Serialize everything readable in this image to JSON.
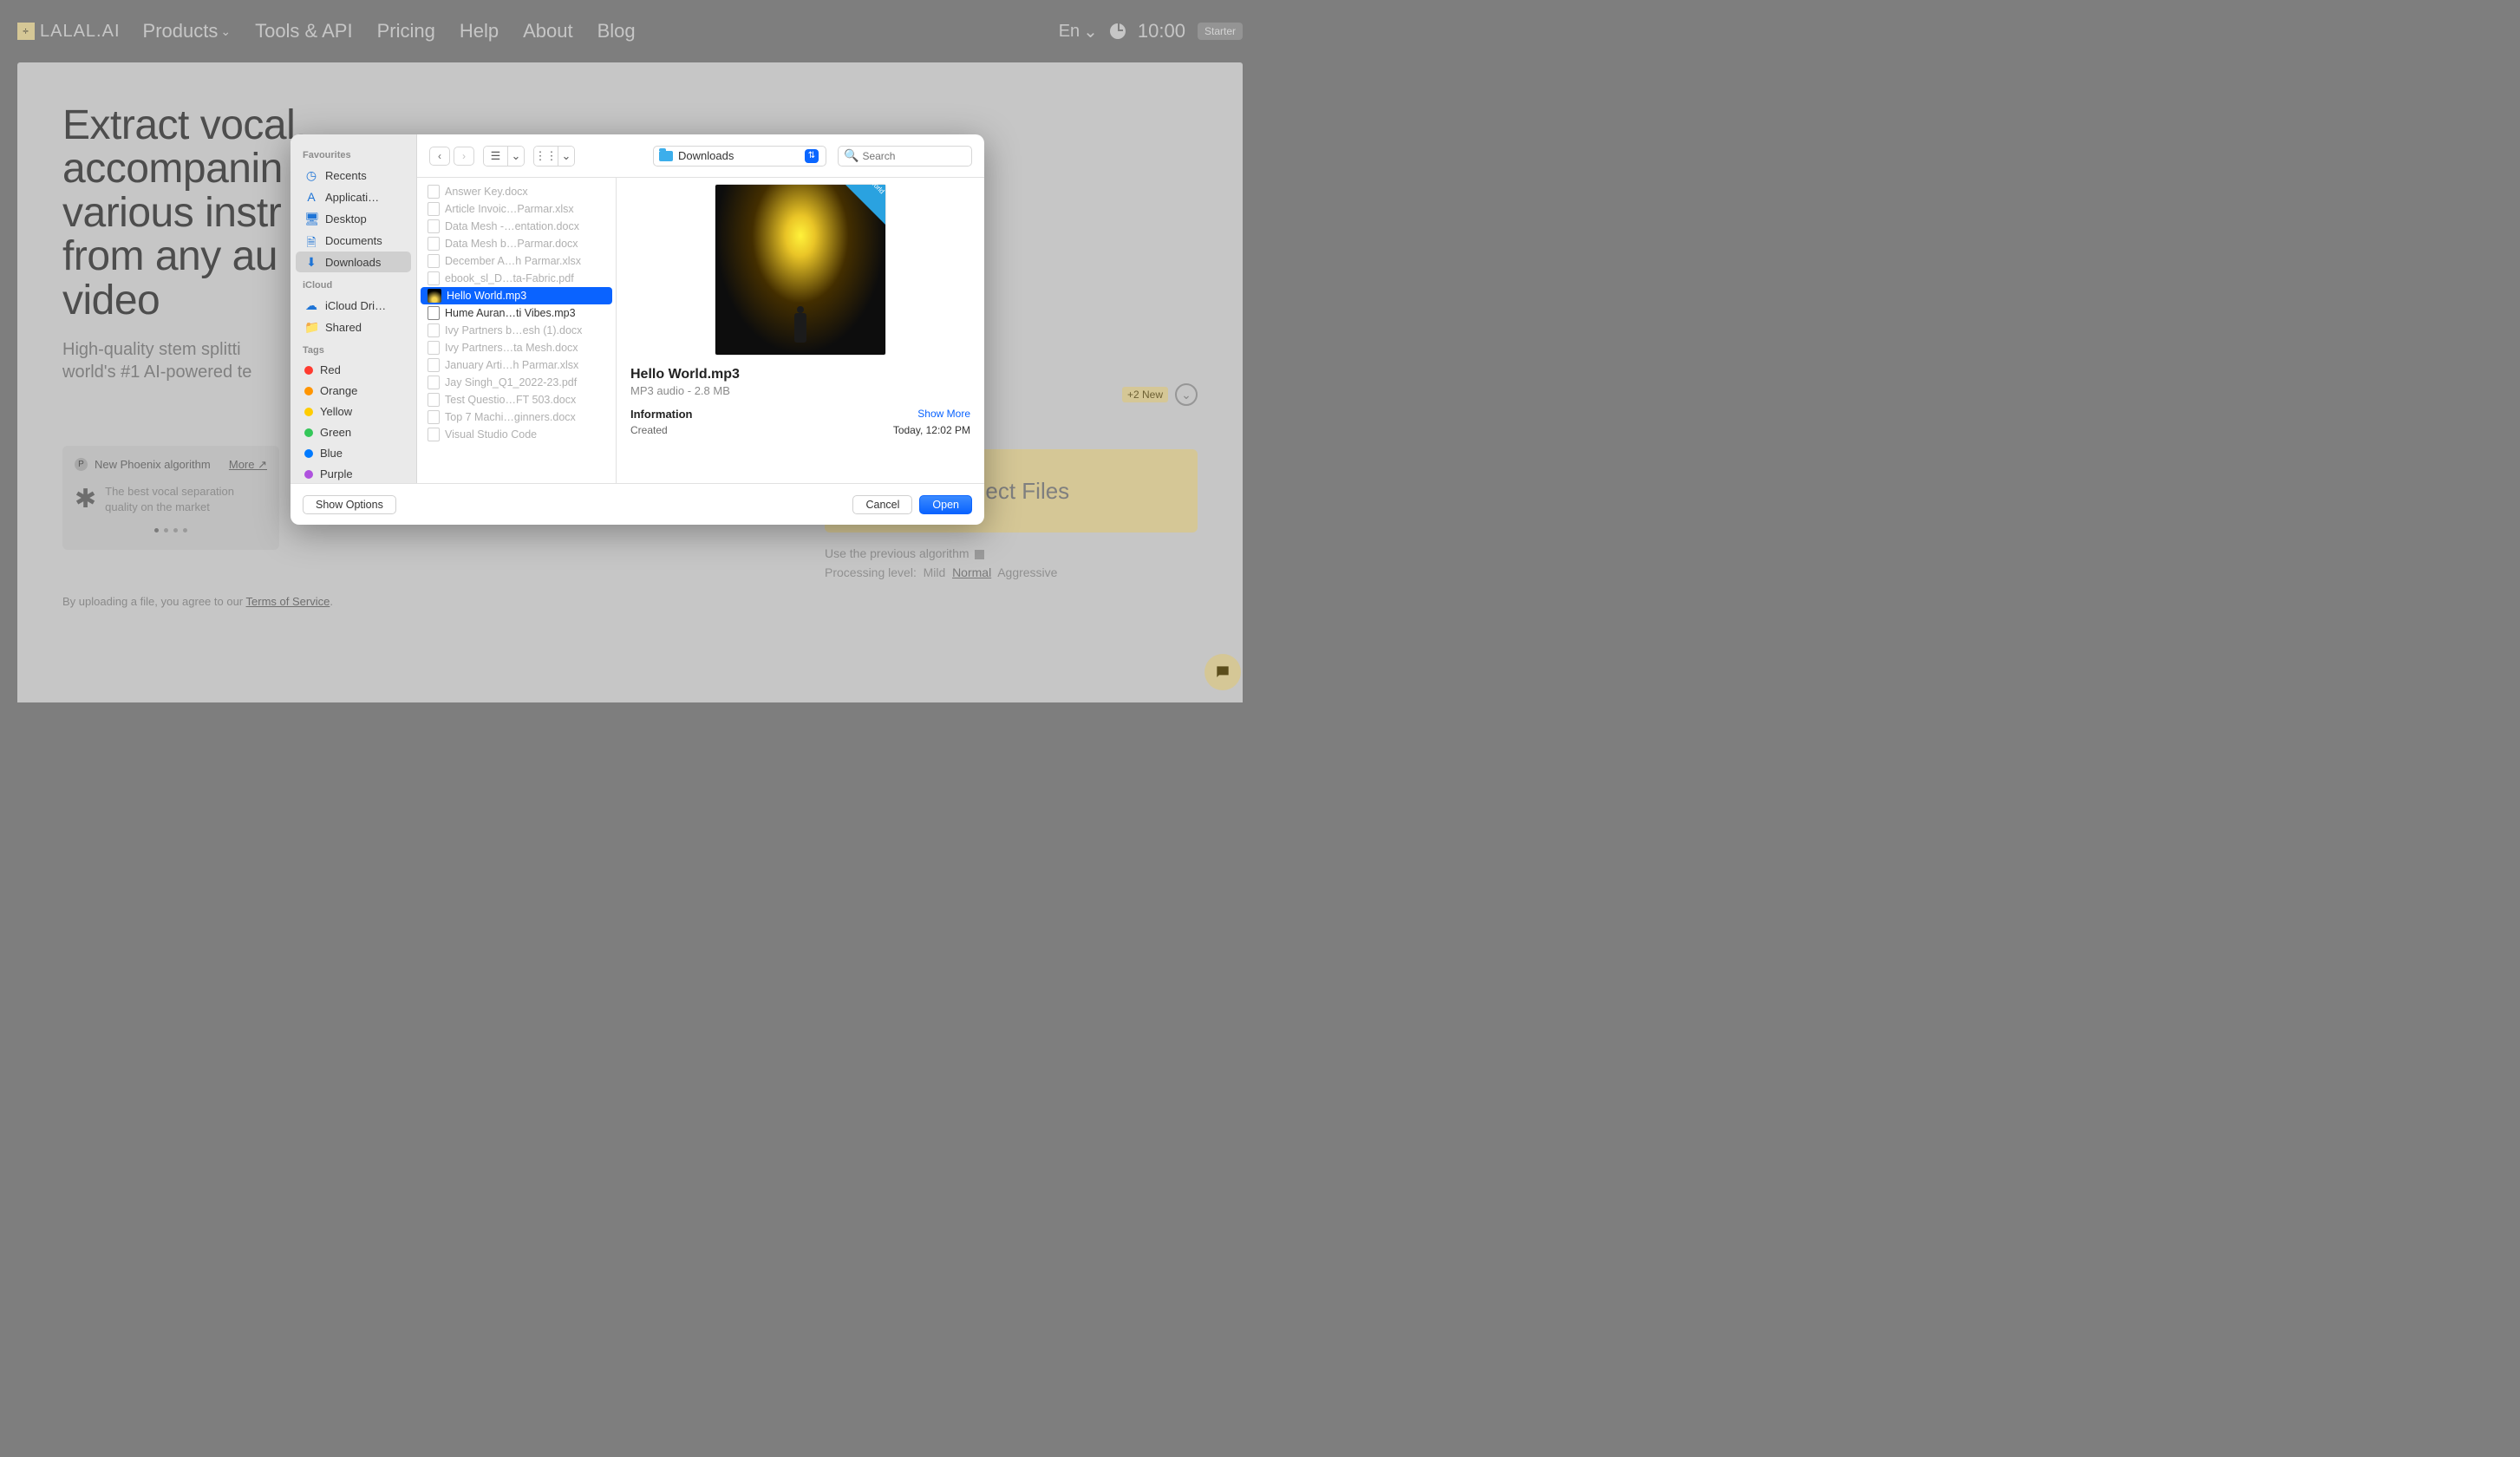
{
  "header": {
    "logo": "LALAL.AI",
    "nav": [
      "Products",
      "Tools & API",
      "Pricing",
      "Help",
      "About",
      "Blog"
    ],
    "lang": "En",
    "time": "10:00",
    "plan": "Starter"
  },
  "hero": {
    "title_l1": "Extract vocal,",
    "title_l2": "accompanin",
    "title_l3": "various instr",
    "title_l4": "from any au",
    "title_l5": "video",
    "sub_l1": "High-quality stem splitti",
    "sub_l2": "world's #1 AI-powered te"
  },
  "promo": {
    "title": "New Phoenix algorithm",
    "more": "More",
    "body_l1": "The best vocal separation",
    "body_l2": "quality on the market"
  },
  "tos_prefix": "By uploading a file, you agree to our ",
  "tos_link": "Terms of Service",
  "right": {
    "new_chip": "+2 New",
    "select_files": "Select Files",
    "opt_prev": "Use the previous algorithm",
    "proc_label": "Processing level:",
    "levels": [
      "Mild",
      "Normal",
      "Aggressive"
    ],
    "selected_level": 1
  },
  "finder": {
    "location": "Downloads",
    "search_placeholder": "Search",
    "sidebar_sections": [
      {
        "title": "Favourites",
        "items": [
          {
            "label": "Recents",
            "icon": "clock"
          },
          {
            "label": "Applicati…",
            "icon": "A"
          },
          {
            "label": "Desktop",
            "icon": "desk"
          },
          {
            "label": "Documents",
            "icon": "doc"
          },
          {
            "label": "Downloads",
            "icon": "down",
            "active": true
          }
        ]
      },
      {
        "title": "iCloud",
        "items": [
          {
            "label": "iCloud Dri…",
            "icon": "cloud"
          },
          {
            "label": "Shared",
            "icon": "folder"
          }
        ]
      },
      {
        "title": "Tags",
        "items": [
          {
            "label": "Red",
            "color": "#ff3b30"
          },
          {
            "label": "Orange",
            "color": "#ff9500"
          },
          {
            "label": "Yellow",
            "color": "#ffcc00"
          },
          {
            "label": "Green",
            "color": "#34c759"
          },
          {
            "label": "Blue",
            "color": "#007aff"
          },
          {
            "label": "Purple",
            "color": "#af52de"
          }
        ]
      }
    ],
    "files": [
      {
        "name": "Answer Key.docx",
        "dim": true,
        "type": "docx"
      },
      {
        "name": "Article Invoic…Parmar.xlsx",
        "dim": true,
        "type": "xlsx"
      },
      {
        "name": "Data Mesh -…entation.docx",
        "dim": true,
        "type": "docx"
      },
      {
        "name": "Data Mesh b…Parmar.docx",
        "dim": true,
        "type": "docx"
      },
      {
        "name": "December A…h Parmar.xlsx",
        "dim": true,
        "type": "xlsx"
      },
      {
        "name": "ebook_sl_D…ta-Fabric.pdf",
        "dim": true,
        "type": "pdf"
      },
      {
        "name": "Hello World.mp3",
        "dim": false,
        "active": true,
        "type": "mp3"
      },
      {
        "name": "Hume Auran…ti Vibes.mp3",
        "dim": false,
        "near": true,
        "type": "mp3"
      },
      {
        "name": "Ivy Partners b…esh (1).docx",
        "dim": true,
        "type": "docx"
      },
      {
        "name": "Ivy Partners…ta Mesh.docx",
        "dim": true,
        "type": "docx"
      },
      {
        "name": "January Arti…h Parmar.xlsx",
        "dim": true,
        "type": "xlsx"
      },
      {
        "name": "Jay Singh_Q1_2022-23.pdf",
        "dim": true,
        "type": "pdf"
      },
      {
        "name": "Test Questio…FT 503.docx",
        "dim": true,
        "type": "docx"
      },
      {
        "name": "Top 7 Machi…ginners.docx",
        "dim": true,
        "type": "docx"
      },
      {
        "name": "Visual Studio Code",
        "dim": true,
        "type": "app"
      }
    ],
    "preview": {
      "title": "Hello World.mp3",
      "sub": "MP3 audio - 2.8 MB",
      "info_label": "Information",
      "show_more": "Show More",
      "created_k": "Created",
      "created_v": "Today, 12:02 PM",
      "corner_tag": "Pagalworld"
    },
    "footer": {
      "show_options": "Show Options",
      "cancel": "Cancel",
      "open": "Open"
    }
  }
}
